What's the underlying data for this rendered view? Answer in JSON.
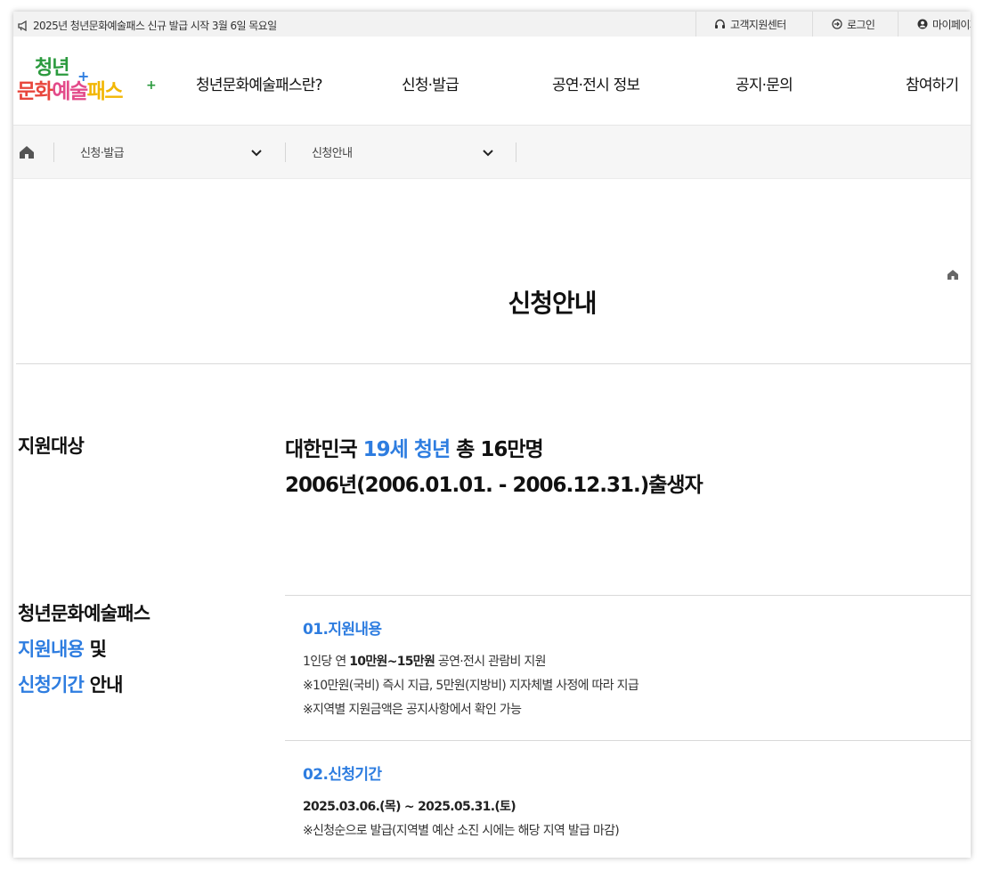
{
  "topbar": {
    "notice": "2025년 청년문화예술패스 신규 발급 시작 3월 6일 목요일",
    "support": "고객지원센터",
    "login": "로그인",
    "mypage": "마이페이지"
  },
  "logo": {
    "line1": "청년",
    "line2_a": "문화",
    "line2_b": "예술",
    "line2_c": "패스",
    "colors": {
      "green": "#2b9a3e",
      "red": "#e8463c",
      "pink": "#e34b8a",
      "yellow": "#f2b705",
      "blue": "#2e7de0"
    }
  },
  "nav": {
    "items": [
      "청년문화예술패스란?",
      "신청·발급",
      "공연·전시 정보",
      "공지·문의",
      "참여하기"
    ]
  },
  "breadcrumb": {
    "depth1": "신청·발급",
    "depth2": "신청안내"
  },
  "page": {
    "title": "신청안내"
  },
  "eligibility": {
    "label": "지원대상",
    "line1_pre": "대한민국 ",
    "line1_highlight": "19세 청년",
    "line1_post": " 총 16만명",
    "line2": "2006년(2006.01.01. - 2006.12.31.)출생자"
  },
  "support_info": {
    "label_line1": "청년문화예술패스",
    "label_line2_highlight": "지원내용",
    "label_line2_post": " 및",
    "label_line3_highlight": "신청기간",
    "label_line3_post": " 안내",
    "items": [
      {
        "title": "01.지원내용",
        "line1_pre": "1인당 연 ",
        "line1_bold": "10만원~15만원",
        "line1_post": " 공연·전시 관람비 지원",
        "line2": "※10만원(국비) 즉시 지급, 5만원(지방비) 지자체별 사정에 따라 지급",
        "line3": "※지역별 지원금액은 공지사항에서 확인 가능"
      },
      {
        "title": "02.신청기간",
        "line1": "2025.03.06.(목) ~ 2025.05.31.(토)",
        "line2": "※신청순으로 발급(지역별 예산 소진 시에는 해당 지역 발급 마감)"
      }
    ]
  },
  "theme": {
    "accent": "#2e7de0"
  }
}
